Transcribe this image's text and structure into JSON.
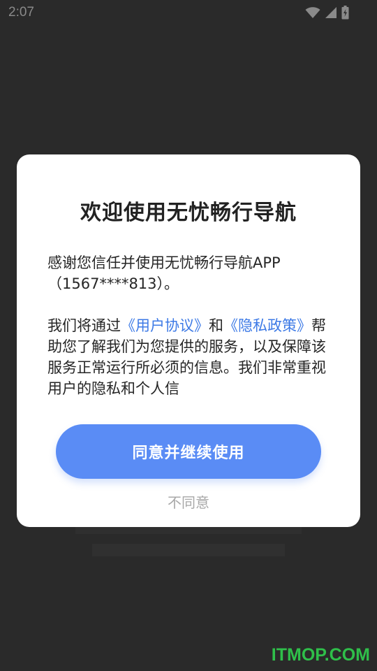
{
  "status_bar": {
    "time": "2:07",
    "icons": [
      "wifi-icon",
      "signal-icon",
      "battery-icon"
    ]
  },
  "dialog": {
    "title": "欢迎使用无忧畅行导航",
    "para1": "感谢您信任并使用无忧畅行导航APP（1567****813）。",
    "para2_part1": "我们将通过",
    "user_agreement_link": "《用户协议》",
    "para2_part2": "和",
    "privacy_policy_link": "《隐私政策》",
    "para2_part3": "帮助您了解我们为您提供的服务，以及保障该服务正常运行所必须的信息。我们非常重视用户的隐私和个人信",
    "agree_label": "同意并继续使用",
    "disagree_label": "不同意"
  },
  "watermark": "ITMOP.COM",
  "colors": {
    "accent": "#5a8cf5",
    "link": "#3d7ae6",
    "overlay": "#2a2a2a",
    "watermark": "#2fbf4a"
  }
}
